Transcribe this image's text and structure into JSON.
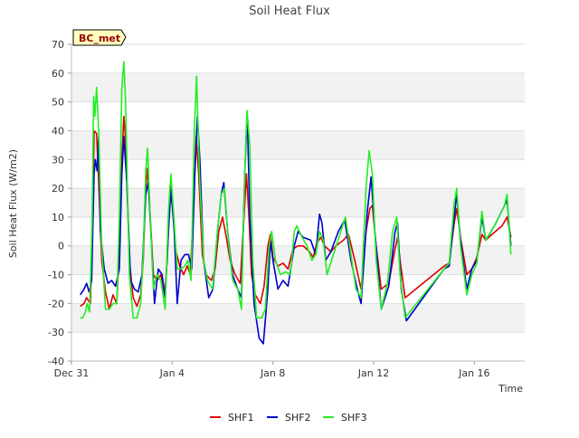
{
  "chart_data": {
    "type": "line",
    "title": "Soil Heat Flux",
    "xlabel": "Time",
    "ylabel": "Soil Heat Flux (W/m2)",
    "site_badge": "BC_met",
    "x_unit": "days since Dec 31",
    "xlim": [
      0,
      18
    ],
    "ylim": [
      -40,
      70
    ],
    "y_ticks": [
      -40,
      -30,
      -20,
      -10,
      0,
      10,
      20,
      30,
      40,
      50,
      60,
      70
    ],
    "x_ticks": [
      {
        "value": 0,
        "label": "Dec 31"
      },
      {
        "value": 4,
        "label": "Jan 4"
      },
      {
        "value": 8,
        "label": "Jan 8"
      },
      {
        "value": 12,
        "label": "Jan 12"
      },
      {
        "value": 16,
        "label": "Jan 16"
      }
    ],
    "grid": true,
    "legend_position": "bottom-center",
    "series": [
      {
        "name": "SHF1",
        "color": "#dd0000",
        "points": [
          [
            0.35,
            -21
          ],
          [
            0.5,
            -20
          ],
          [
            0.6,
            -18
          ],
          [
            0.75,
            -20
          ],
          [
            0.85,
            10
          ],
          [
            0.9,
            40
          ],
          [
            1.0,
            39
          ],
          [
            1.08,
            22
          ],
          [
            1.2,
            -5
          ],
          [
            1.35,
            -16
          ],
          [
            1.5,
            -22
          ],
          [
            1.65,
            -17
          ],
          [
            1.8,
            -20
          ],
          [
            1.9,
            0
          ],
          [
            2.0,
            30
          ],
          [
            2.08,
            45
          ],
          [
            2.15,
            37
          ],
          [
            2.3,
            -5
          ],
          [
            2.45,
            -18
          ],
          [
            2.6,
            -21
          ],
          [
            2.75,
            -17
          ],
          [
            2.85,
            -5
          ],
          [
            2.95,
            20
          ],
          [
            3.02,
            27
          ],
          [
            3.12,
            12
          ],
          [
            3.25,
            -10
          ],
          [
            3.4,
            -12
          ],
          [
            3.55,
            -10
          ],
          [
            3.7,
            -17
          ],
          [
            3.8,
            -5
          ],
          [
            3.92,
            21
          ],
          [
            4.05,
            10
          ],
          [
            4.15,
            -2
          ],
          [
            4.3,
            -7
          ],
          [
            4.45,
            -10
          ],
          [
            4.6,
            -7
          ],
          [
            4.72,
            -10
          ],
          [
            4.85,
            15
          ],
          [
            4.95,
            38
          ],
          [
            5.05,
            25
          ],
          [
            5.2,
            -3
          ],
          [
            5.35,
            -10
          ],
          [
            5.55,
            -12
          ],
          [
            5.7,
            -8
          ],
          [
            5.85,
            5
          ],
          [
            6.0,
            10
          ],
          [
            6.15,
            3
          ],
          [
            6.3,
            -5
          ],
          [
            6.5,
            -10
          ],
          [
            6.7,
            -13
          ],
          [
            6.85,
            10
          ],
          [
            6.95,
            25
          ],
          [
            7.05,
            10
          ],
          [
            7.15,
            -10
          ],
          [
            7.3,
            -17
          ],
          [
            7.5,
            -20
          ],
          [
            7.65,
            -14
          ],
          [
            7.8,
            0
          ],
          [
            7.9,
            4
          ],
          [
            8.0,
            -4
          ],
          [
            8.2,
            -7
          ],
          [
            8.4,
            -6
          ],
          [
            8.6,
            -8
          ],
          [
            8.8,
            -1
          ],
          [
            9.0,
            0
          ],
          [
            9.2,
            0
          ],
          [
            9.45,
            -2
          ],
          [
            9.6,
            -4
          ],
          [
            9.75,
            1
          ],
          [
            9.9,
            3
          ],
          [
            10.05,
            0
          ],
          [
            10.3,
            -2
          ],
          [
            10.5,
            0
          ],
          [
            10.8,
            2
          ],
          [
            11.0,
            4
          ],
          [
            11.25,
            -5
          ],
          [
            11.5,
            -15
          ],
          [
            11.7,
            5
          ],
          [
            11.85,
            13
          ],
          [
            11.95,
            14
          ],
          [
            12.1,
            0
          ],
          [
            12.3,
            -15
          ],
          [
            12.6,
            -13
          ],
          [
            12.85,
            -1
          ],
          [
            12.95,
            3
          ],
          [
            13.05,
            -5
          ],
          [
            13.25,
            -18
          ],
          [
            14.8,
            -7
          ],
          [
            15.0,
            -6
          ],
          [
            15.2,
            8
          ],
          [
            15.3,
            13
          ],
          [
            15.45,
            3
          ],
          [
            15.7,
            -10
          ],
          [
            15.9,
            -8
          ],
          [
            16.1,
            -4
          ],
          [
            16.3,
            4
          ],
          [
            16.45,
            2
          ],
          [
            16.7,
            4
          ],
          [
            17.1,
            7
          ],
          [
            17.3,
            10
          ],
          [
            17.45,
            3
          ]
        ]
      },
      {
        "name": "SHF2",
        "color": "#0000cc",
        "points": [
          [
            0.35,
            -17
          ],
          [
            0.5,
            -15
          ],
          [
            0.6,
            -13
          ],
          [
            0.7,
            -16
          ],
          [
            0.8,
            -12
          ],
          [
            0.9,
            25
          ],
          [
            0.95,
            30
          ],
          [
            1.02,
            26
          ],
          [
            1.08,
            38
          ],
          [
            1.15,
            5
          ],
          [
            1.3,
            -8
          ],
          [
            1.45,
            -13
          ],
          [
            1.6,
            -12
          ],
          [
            1.75,
            -14
          ],
          [
            1.9,
            -8
          ],
          [
            2.0,
            25
          ],
          [
            2.08,
            38
          ],
          [
            2.2,
            22
          ],
          [
            2.35,
            -12
          ],
          [
            2.5,
            -15
          ],
          [
            2.65,
            -16
          ],
          [
            2.8,
            -10
          ],
          [
            2.95,
            18
          ],
          [
            3.05,
            22
          ],
          [
            3.15,
            5
          ],
          [
            3.3,
            -20
          ],
          [
            3.45,
            -8
          ],
          [
            3.6,
            -10
          ],
          [
            3.72,
            -18
          ],
          [
            3.85,
            5
          ],
          [
            3.95,
            20
          ],
          [
            4.08,
            5
          ],
          [
            4.2,
            -20
          ],
          [
            4.35,
            -5
          ],
          [
            4.5,
            -3
          ],
          [
            4.65,
            -3
          ],
          [
            4.78,
            -8
          ],
          [
            4.9,
            25
          ],
          [
            5.0,
            45
          ],
          [
            5.1,
            30
          ],
          [
            5.25,
            -5
          ],
          [
            5.45,
            -18
          ],
          [
            5.62,
            -15
          ],
          [
            5.8,
            5
          ],
          [
            5.95,
            18
          ],
          [
            6.05,
            22
          ],
          [
            6.2,
            5
          ],
          [
            6.4,
            -10
          ],
          [
            6.6,
            -15
          ],
          [
            6.75,
            -18
          ],
          [
            6.88,
            25
          ],
          [
            6.98,
            46
          ],
          [
            7.08,
            10
          ],
          [
            7.25,
            -20
          ],
          [
            7.45,
            -32
          ],
          [
            7.62,
            -34
          ],
          [
            7.8,
            -15
          ],
          [
            7.9,
            2
          ],
          [
            8.0,
            -5
          ],
          [
            8.2,
            -15
          ],
          [
            8.4,
            -12
          ],
          [
            8.6,
            -14
          ],
          [
            8.85,
            0
          ],
          [
            9.0,
            5
          ],
          [
            9.2,
            3
          ],
          [
            9.5,
            2
          ],
          [
            9.7,
            -3
          ],
          [
            9.85,
            11
          ],
          [
            9.95,
            8
          ],
          [
            10.1,
            -5
          ],
          [
            10.3,
            -2
          ],
          [
            10.6,
            5
          ],
          [
            10.85,
            9
          ],
          [
            11.1,
            -5
          ],
          [
            11.35,
            -15
          ],
          [
            11.5,
            -20
          ],
          [
            11.75,
            12
          ],
          [
            11.9,
            24
          ],
          [
            12.05,
            5
          ],
          [
            12.3,
            -22
          ],
          [
            12.6,
            -14
          ],
          [
            12.85,
            5
          ],
          [
            12.95,
            8
          ],
          [
            13.1,
            -15
          ],
          [
            13.3,
            -26
          ],
          [
            14.8,
            -8
          ],
          [
            15.0,
            -7
          ],
          [
            15.2,
            10
          ],
          [
            15.3,
            18
          ],
          [
            15.45,
            2
          ],
          [
            15.7,
            -15
          ],
          [
            15.9,
            -8
          ],
          [
            16.1,
            -5
          ],
          [
            16.3,
            10
          ],
          [
            16.45,
            2
          ],
          [
            16.8,
            7
          ],
          [
            17.2,
            14
          ],
          [
            17.3,
            16
          ],
          [
            17.45,
            0
          ]
        ]
      },
      {
        "name": "SHF3",
        "color": "#22ee22",
        "points": [
          [
            0.35,
            -25
          ],
          [
            0.45,
            -25
          ],
          [
            0.55,
            -23
          ],
          [
            0.62,
            -20
          ],
          [
            0.72,
            -23
          ],
          [
            0.82,
            8
          ],
          [
            0.88,
            52
          ],
          [
            0.93,
            45
          ],
          [
            1.0,
            55
          ],
          [
            1.08,
            40
          ],
          [
            1.2,
            0
          ],
          [
            1.35,
            -22
          ],
          [
            1.5,
            -22
          ],
          [
            1.65,
            -20
          ],
          [
            1.8,
            -20
          ],
          [
            1.9,
            10
          ],
          [
            2.0,
            55
          ],
          [
            2.08,
            64
          ],
          [
            2.15,
            50
          ],
          [
            2.3,
            -10
          ],
          [
            2.45,
            -25
          ],
          [
            2.6,
            -25
          ],
          [
            2.75,
            -20
          ],
          [
            2.85,
            -3
          ],
          [
            2.95,
            26
          ],
          [
            3.02,
            34
          ],
          [
            3.12,
            12
          ],
          [
            3.25,
            -15
          ],
          [
            3.4,
            -10
          ],
          [
            3.55,
            -12
          ],
          [
            3.72,
            -22
          ],
          [
            3.85,
            12
          ],
          [
            3.95,
            25
          ],
          [
            4.08,
            8
          ],
          [
            4.2,
            -8
          ],
          [
            4.35,
            -8
          ],
          [
            4.5,
            -7
          ],
          [
            4.62,
            -5
          ],
          [
            4.75,
            -12
          ],
          [
            4.88,
            40
          ],
          [
            4.97,
            59
          ],
          [
            5.08,
            25
          ],
          [
            5.25,
            -5
          ],
          [
            5.4,
            -12
          ],
          [
            5.6,
            -15
          ],
          [
            5.8,
            5
          ],
          [
            5.95,
            18
          ],
          [
            6.08,
            20
          ],
          [
            6.2,
            5
          ],
          [
            6.4,
            -12
          ],
          [
            6.6,
            -15
          ],
          [
            6.75,
            -22
          ],
          [
            6.88,
            25
          ],
          [
            6.97,
            47
          ],
          [
            7.08,
            35
          ],
          [
            7.2,
            -5
          ],
          [
            7.35,
            -25
          ],
          [
            7.55,
            -25
          ],
          [
            7.7,
            -22
          ],
          [
            7.85,
            0
          ],
          [
            7.95,
            5
          ],
          [
            8.1,
            -5
          ],
          [
            8.3,
            -10
          ],
          [
            8.5,
            -9
          ],
          [
            8.7,
            -10
          ],
          [
            8.85,
            5
          ],
          [
            8.95,
            7
          ],
          [
            9.1,
            4
          ],
          [
            9.35,
            0
          ],
          [
            9.55,
            -5
          ],
          [
            9.7,
            -3
          ],
          [
            9.85,
            5
          ],
          [
            10.0,
            2
          ],
          [
            10.15,
            -10
          ],
          [
            10.4,
            -3
          ],
          [
            10.7,
            5
          ],
          [
            10.88,
            10
          ],
          [
            11.1,
            -3
          ],
          [
            11.3,
            -15
          ],
          [
            11.5,
            -18
          ],
          [
            11.7,
            20
          ],
          [
            11.82,
            33
          ],
          [
            11.95,
            25
          ],
          [
            12.1,
            -5
          ],
          [
            12.3,
            -22
          ],
          [
            12.55,
            -13
          ],
          [
            12.75,
            5
          ],
          [
            12.92,
            10
          ],
          [
            13.05,
            -10
          ],
          [
            13.25,
            -25
          ],
          [
            14.8,
            -8
          ],
          [
            15.0,
            -6
          ],
          [
            15.2,
            15
          ],
          [
            15.3,
            20
          ],
          [
            15.45,
            0
          ],
          [
            15.7,
            -17
          ],
          [
            15.9,
            -10
          ],
          [
            16.1,
            -6
          ],
          [
            16.3,
            12
          ],
          [
            16.45,
            2
          ],
          [
            16.8,
            7
          ],
          [
            17.2,
            14
          ],
          [
            17.3,
            18
          ],
          [
            17.45,
            -3
          ]
        ]
      }
    ]
  }
}
